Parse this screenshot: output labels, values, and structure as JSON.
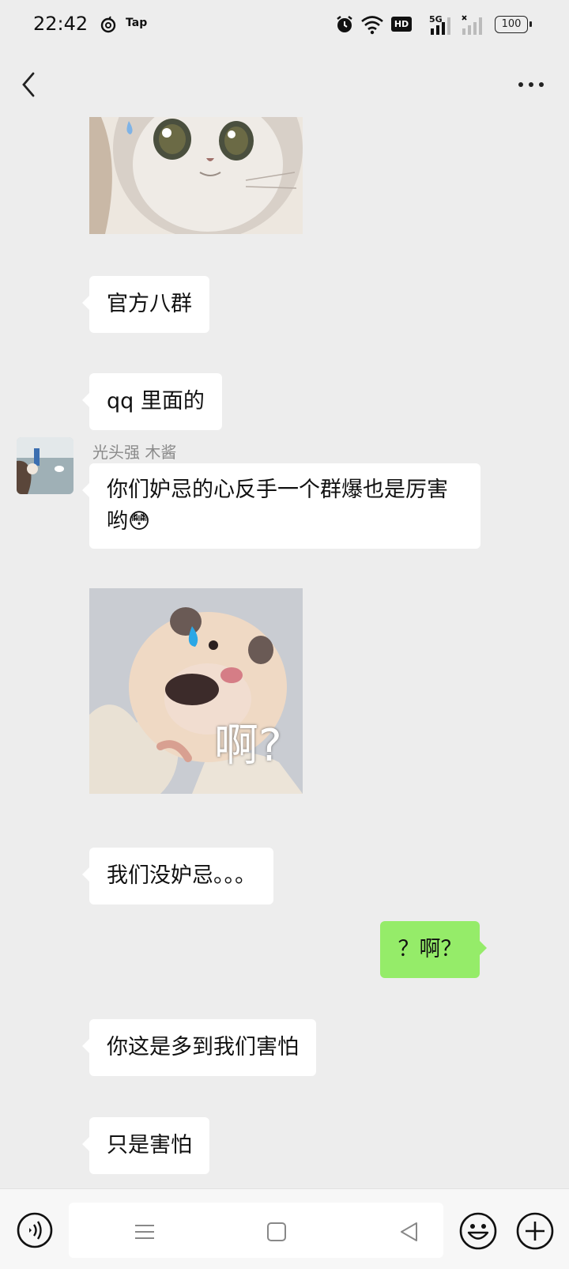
{
  "status_bar": {
    "time": "22:42",
    "app_label": "Tap",
    "network_label": "5G",
    "hd_label": "HD",
    "battery": "100"
  },
  "messages": [
    {
      "type": "image",
      "sender": "other",
      "description_icon": "cat-sticker"
    },
    {
      "type": "text",
      "sender": "other",
      "text": "官方八群"
    },
    {
      "type": "text",
      "sender": "other",
      "text": "qq 里面的"
    },
    {
      "type": "text",
      "sender": "other",
      "name": "光头强 木酱",
      "text": "你们妒忌的心反手一个群爆也是厉害哟😳"
    },
    {
      "type": "image",
      "sender": "other",
      "caption": "啊?",
      "description_icon": "hamster-sticker"
    },
    {
      "type": "text",
      "sender": "other",
      "text": "我们没妒忌。。。"
    },
    {
      "type": "text",
      "sender": "me",
      "text": "？啊？"
    },
    {
      "type": "text",
      "sender": "other",
      "text": "你这是多到我们害怕"
    },
    {
      "type": "text",
      "sender": "other",
      "text": "只是害怕"
    }
  ],
  "colors": {
    "background": "#ededed",
    "my_bubble": "#95ec69",
    "other_bubble": "#ffffff"
  }
}
